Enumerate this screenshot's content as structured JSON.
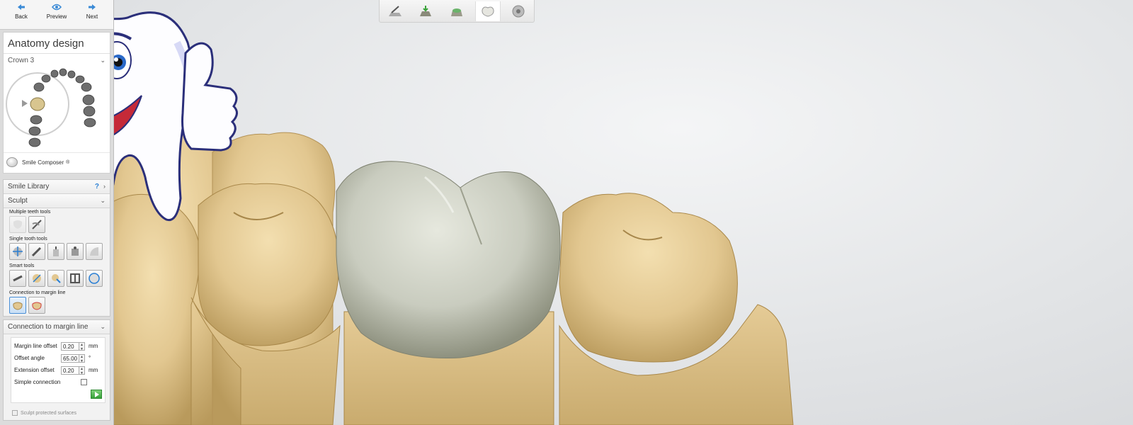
{
  "nav": {
    "back_label": "Back",
    "preview_label": "Preview",
    "next_label": "Next"
  },
  "panel": {
    "title": "Anatomy design",
    "crown_select": "Crown 3",
    "smile_composer": "Smile Composer",
    "smile_composer_mark": "®"
  },
  "library": {
    "header": "Smile Library",
    "help": "?",
    "sculpt_header": "Sculpt",
    "groups": {
      "multiple": "Multiple teeth tools",
      "single": "Single tooth tools",
      "smart": "Smart tools",
      "connection": "Connection to margin line"
    }
  },
  "connection": {
    "header": "Connection to margin line",
    "params": [
      {
        "label": "Margin line offset",
        "value": "0.20",
        "unit": "mm"
      },
      {
        "label": "Offset angle",
        "value": "65.00",
        "unit": "°"
      },
      {
        "label": "Extension offset",
        "value": "0.20",
        "unit": "mm"
      }
    ],
    "simple_connection": "Simple connection",
    "sculpt_protected": "Sculpt protected surfaces"
  },
  "icons": {
    "top_toolbar": [
      "scan-tool-icon",
      "margin-icon",
      "abutment-icon",
      "crown-icon",
      "disc-icon"
    ],
    "nav": [
      "arrow-left-icon",
      "eye-icon",
      "arrow-right-icon"
    ]
  },
  "colors": {
    "accent": "#2a7fd4",
    "tooth_model": "#e8cf9c",
    "crown": "#cfd2c5",
    "play": "#36a23a"
  }
}
